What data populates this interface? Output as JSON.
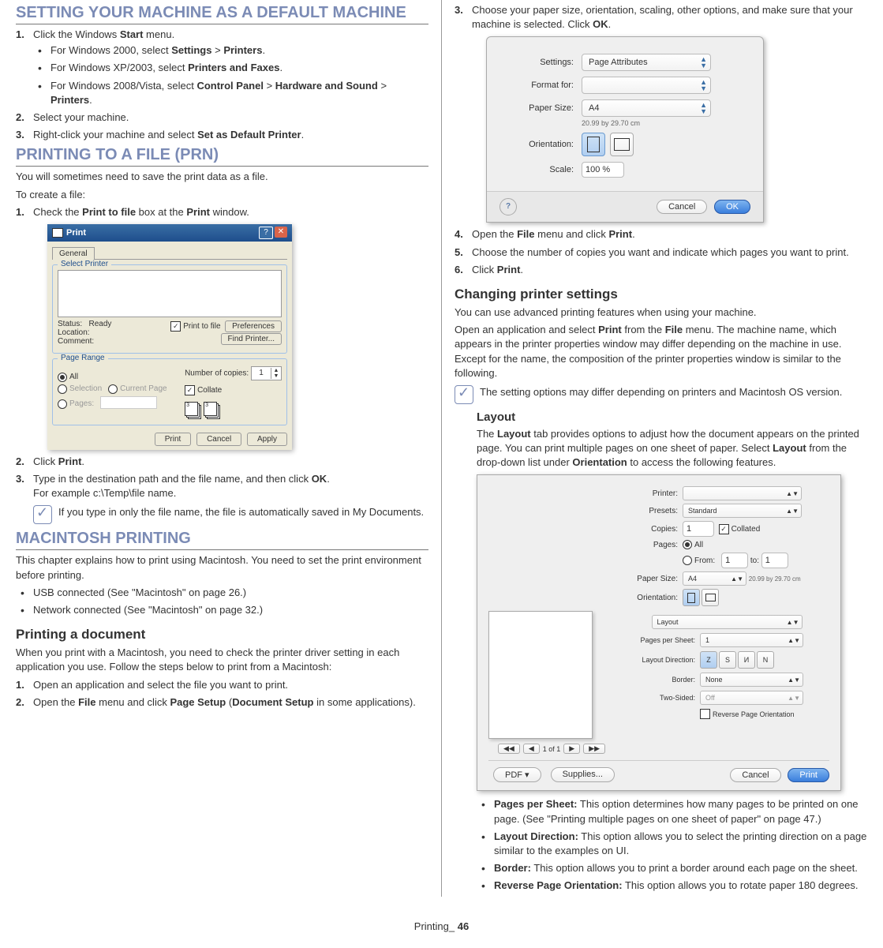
{
  "left": {
    "h1": "SETTING YOUR MACHINE AS A DEFAULT MACHINE",
    "s1_li1_pre": "Click the Windows ",
    "s1_li1_b": "Start",
    "s1_li1_post": " menu.",
    "s1_li1_a_pre": "For Windows 2000, select ",
    "s1_li1_a_b1": "Settings",
    "s1_li1_a_mid": " > ",
    "s1_li1_a_b2": "Printers",
    "s1_li1_a_post": ".",
    "s1_li1_b_pre": "For Windows XP/2003, select ",
    "s1_li1_b_b1": "Printers and Faxes",
    "s1_li1_b_post": ".",
    "s1_li1_c_pre": "For Windows 2008/Vista, select ",
    "s1_li1_c_b1": "Control Panel",
    "s1_li1_c_mid": " > ",
    "s1_li1_c_b2": "Hardware and Sound",
    "s1_li1_c_mid2": " > ",
    "s1_li1_c_b3": "Printers",
    "s1_li1_c_post": ".",
    "s1_li2": "Select your machine.",
    "s1_li3_pre": "Right-click your machine and select ",
    "s1_li3_b": "Set as Default Printer",
    "s1_li3_post": ".",
    "h2": "PRINTING TO A FILE (PRN)",
    "p2a": "You will sometimes need to save the print data as a file.",
    "p2b": "To create a file:",
    "s2_li1_pre": "Check the ",
    "s2_li1_b1": "Print to file",
    "s2_li1_mid": " box at the ",
    "s2_li1_b2": "Print",
    "s2_li1_post": " window.",
    "s2_li2_pre": "Click ",
    "s2_li2_b": "Print",
    "s2_li2_post": ".",
    "s2_li3_pre": "Type in the destination path and the file name, and then click ",
    "s2_li3_b": "OK",
    "s2_li3_post": ".",
    "s2_li3_ex": "For example c:\\Temp\\file name.",
    "note1": "If you type in only the file name, the file is automatically saved in My Documents.",
    "h3": "MACINTOSH PRINTING",
    "p3a": "This chapter explains how to print using Macintosh. You need to set the print environment before printing.",
    "s3_b1": "USB connected (See \"Macintosh\" on page 26.)",
    "s3_b2": "Network connected (See \"Macintosh\" on page 32.)",
    "h3a": "Printing a document",
    "p3b": "When you print with a Macintosh, you need to check the printer driver setting in each application you use. Follow the steps below to print from a Macintosh:",
    "s3_li1": "Open an application and select the file you want to print.",
    "s3_li2_pre": "Open the ",
    "s3_li2_b1": "File",
    "s3_li2_mid": " menu and click ",
    "s3_li2_b2": "Page Setup",
    "s3_li2_mid2": " (",
    "s3_li2_b3": "Document Setup",
    "s3_li2_post": " in some applications)."
  },
  "right": {
    "s3_li3_pre": "Choose your paper size, orientation, scaling, other options, and make sure that your machine is selected. Click ",
    "s3_li3_b": "OK",
    "s3_li3_post": ".",
    "s3_li4_pre": "Open the ",
    "s3_li4_b1": "File",
    "s3_li4_mid": " menu and click ",
    "s3_li4_b2": "Print",
    "s3_li4_post": ".",
    "s3_li5": "Choose the number of copies you want and indicate which pages you want to print.",
    "s3_li6_pre": "Click ",
    "s3_li6_b": "Print",
    "s3_li6_post": ".",
    "h4": "Changing printer settings",
    "p4a": "You can use advanced printing features when using your machine.",
    "p4b_pre": "Open an application and select ",
    "p4b_b1": "Print",
    "p4b_mid": " from the ",
    "p4b_b2": "File",
    "p4b_post": " menu. The machine name, which appears in the printer properties window may differ depending on the machine in use. Except for the name, the composition of the printer properties window is similar to the following.",
    "note2": "The setting options may differ depending on printers and Macintosh OS version.",
    "h5": "Layout",
    "p5_pre": "The ",
    "p5_b1": "Layout",
    "p5_mid1": " tab provides options to adjust how the document appears on the printed page. You can print multiple pages on one sheet of paper. Select ",
    "p5_b2": "Layout",
    "p5_mid2": " from the drop-down list under ",
    "p5_b3": "Orientation",
    "p5_post": " to access the following features.",
    "bl1_b": "Pages per Sheet:",
    "bl1_t": "  This option determines how many pages to be printed on one page. (See \"Printing multiple pages on one sheet of paper\" on page 47.)",
    "bl2_b": "Layout Direction:",
    "bl2_t": "  This option allows you to select the printing direction on a page similar to the examples on UI.",
    "bl3_b": "Border:",
    "bl3_t": "  This option allows you to print a border around each page on the sheet.",
    "bl4_b": "Reverse Page Orientation:",
    "bl4_t": "  This option allows you to rotate paper 180 degrees."
  },
  "printDialog": {
    "title": "Print",
    "tab": "General",
    "fsSelect": "Select Printer",
    "status": "Status:",
    "statusVal": "Ready",
    "location": "Location:",
    "comment": "Comment:",
    "printToFile": "Print to file",
    "prefs": "Preferences",
    "find": "Find Printer...",
    "fsRange": "Page Range",
    "all": "All",
    "selection": "Selection",
    "current": "Current Page",
    "pages": "Pages:",
    "copies": "Number of copies:",
    "copiesVal": "1",
    "collate": "Collate",
    "print": "Print",
    "cancel": "Cancel",
    "apply": "Apply"
  },
  "macSetup": {
    "settings": "Settings:",
    "settingsVal": "Page Attributes",
    "format": "Format for:",
    "paper": "Paper Size:",
    "paperVal": "A4",
    "paperSub": "20.99 by 29.70 cm",
    "orient": "Orientation:",
    "scale": "Scale:",
    "scaleVal": "100 %",
    "cancel": "Cancel",
    "ok": "OK"
  },
  "macPrint": {
    "printer": "Printer:",
    "presets": "Presets:",
    "presetsVal": "Standard",
    "copies": "Copies:",
    "copiesVal": "1",
    "collated": "Collated",
    "pages": "Pages:",
    "all": "All",
    "from": "From:",
    "fromVal": "1",
    "to": "to:",
    "toVal": "1",
    "paperSize": "Paper Size:",
    "paperVal": "A4",
    "paperSub": "20.99 by 29.70 cm",
    "orient": "Orientation:",
    "layout": "Layout",
    "pps": "Pages per Sheet:",
    "ppsVal": "1",
    "ld": "Layout Direction:",
    "border": "Border:",
    "borderVal": "None",
    "twoSided": "Two-Sided:",
    "twoSidedVal": "Off",
    "reverse": "Reverse Page Orientation",
    "navOf": "1 of 1",
    "pdf": "PDF ▾",
    "supplies": "Supplies...",
    "cancel": "Cancel",
    "print": "Print"
  },
  "footer": {
    "label": "Printing_ ",
    "page": "46"
  }
}
